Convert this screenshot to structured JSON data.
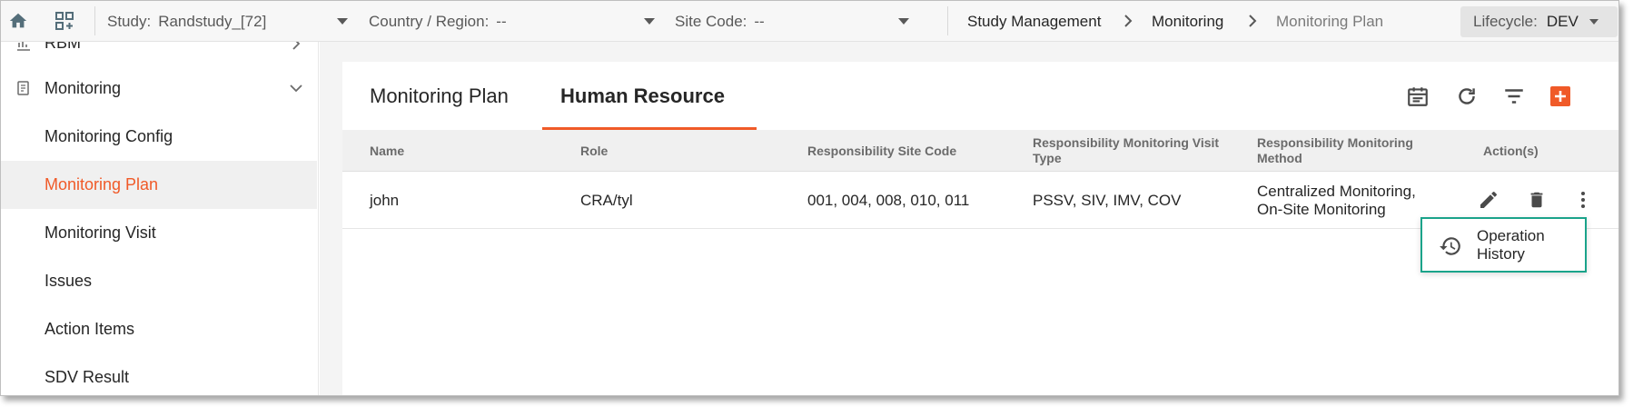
{
  "topbar": {
    "home_icon": "home-icon",
    "apps_icon": "apps-add-icon",
    "study_label": "Study:",
    "study_value": "Randstudy_[72]",
    "country_label": "Country / Region:",
    "country_value": "--",
    "site_label": "Site Code:",
    "site_value": "--",
    "breadcrumb": [
      "Study Management",
      "Monitoring",
      "Monitoring Plan"
    ],
    "lifecycle_label": "Lifecycle:",
    "lifecycle_value": "DEV"
  },
  "sidebar": {
    "top_partial": "RBM",
    "section": "Monitoring",
    "items": [
      "Monitoring Config",
      "Monitoring Plan",
      "Monitoring Visit",
      "Issues",
      "Action Items",
      "SDV Result"
    ],
    "active": "Monitoring Plan"
  },
  "main": {
    "tabs": [
      "Monitoring Plan",
      "Human Resource"
    ],
    "active_tab": "Human Resource",
    "tools": [
      "calendar-icon",
      "refresh-icon",
      "filter-icon",
      "add-icon"
    ],
    "table": {
      "headers": {
        "name": "Name",
        "role": "Role",
        "site_code": "Responsibility Site Code",
        "visit_type_1": "Responsibility Monitoring Visit",
        "visit_type_2": "Type",
        "method_1": "Responsibility Monitoring",
        "method_2": "Method",
        "actions": "Action(s)"
      },
      "rows": [
        {
          "name": "john",
          "role": "CRA/tyl",
          "site_code": "001, 004, 008, 010, 011",
          "visit_type": "PSSV, SIV, IMV, COV",
          "method_1": "Centralized Monitoring,",
          "method_2": "On-Site Monitoring"
        }
      ]
    },
    "popup": {
      "label": "Operation History"
    }
  },
  "colors": {
    "accent": "#f05a28",
    "popup_border": "#1aa38a"
  }
}
